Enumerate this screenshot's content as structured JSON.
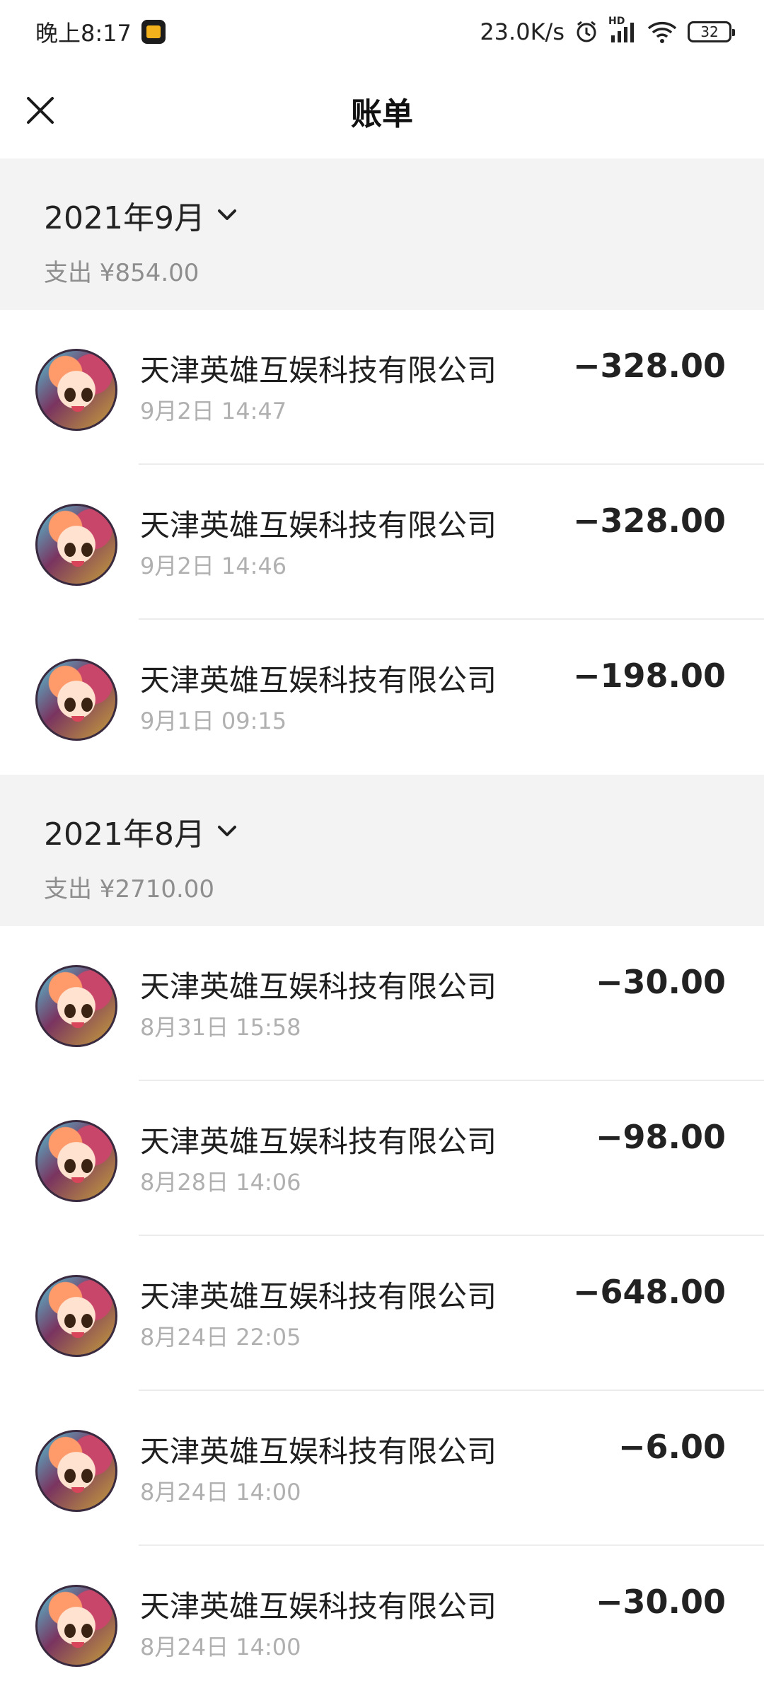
{
  "status_bar": {
    "time": "晚上8:17",
    "net_speed": "23.0K/s",
    "signal_tag": "HD",
    "battery": "32"
  },
  "header": {
    "title": "账单"
  },
  "months": [
    {
      "title": "2021年9月",
      "summary": "支出 ¥854.00",
      "transactions": [
        {
          "name": "天津英雄互娱科技有限公司",
          "time": "9月2日 14:47",
          "amount": "−328.00"
        },
        {
          "name": "天津英雄互娱科技有限公司",
          "time": "9月2日 14:46",
          "amount": "−328.00"
        },
        {
          "name": "天津英雄互娱科技有限公司",
          "time": "9月1日 09:15",
          "amount": "−198.00"
        }
      ]
    },
    {
      "title": "2021年8月",
      "summary": "支出 ¥2710.00",
      "transactions": [
        {
          "name": "天津英雄互娱科技有限公司",
          "time": "8月31日 15:58",
          "amount": "−30.00"
        },
        {
          "name": "天津英雄互娱科技有限公司",
          "time": "8月28日 14:06",
          "amount": "−98.00"
        },
        {
          "name": "天津英雄互娱科技有限公司",
          "time": "8月24日 22:05",
          "amount": "−648.00"
        },
        {
          "name": "天津英雄互娱科技有限公司",
          "time": "8月24日 14:00",
          "amount": "−6.00"
        },
        {
          "name": "天津英雄互娱科技有限公司",
          "time": "8月24日 14:00",
          "amount": "−30.00"
        }
      ]
    }
  ]
}
